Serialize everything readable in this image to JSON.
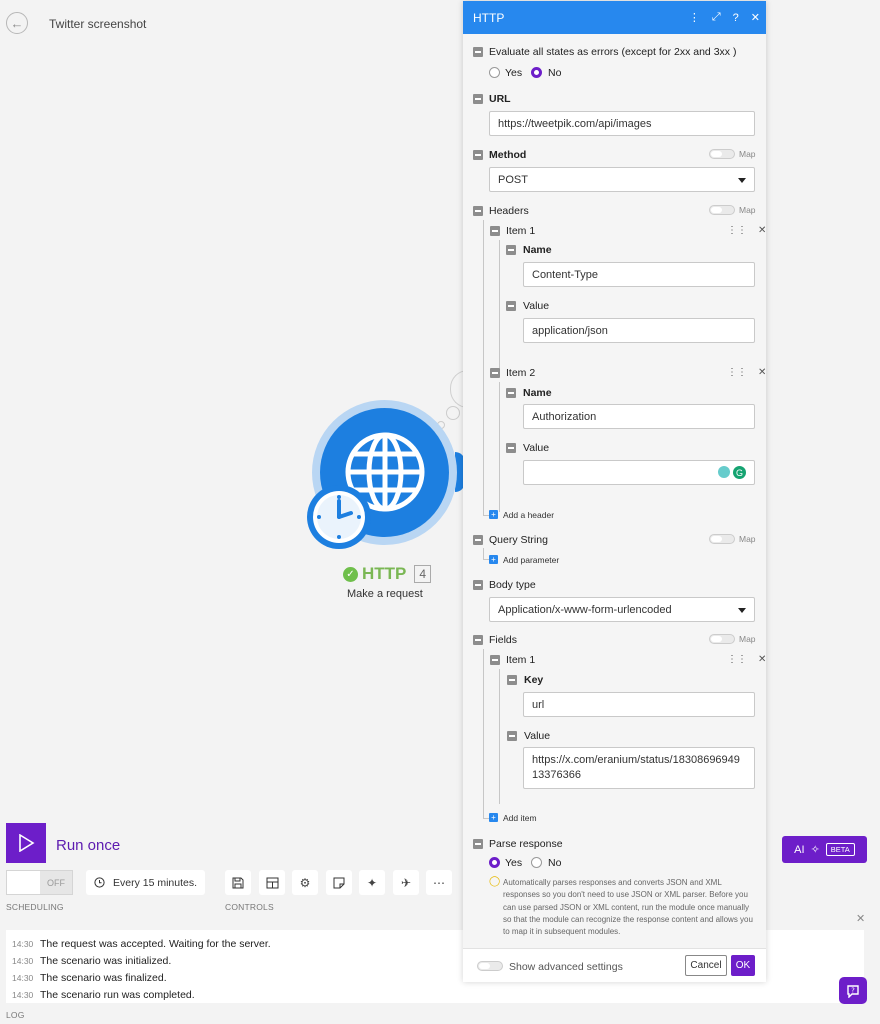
{
  "scenario": {
    "title": "Twitter screenshot"
  },
  "module": {
    "name": "HTTP",
    "count": "4",
    "subtitle": "Make a request"
  },
  "toolbar": {
    "run_label": "Run once",
    "toggle_state": "OFF",
    "schedule": "Every 15 minutes.",
    "scheduling_caption": "SCHEDULING",
    "controls_caption": "CONTROLS",
    "ai_label": "AI",
    "beta_label": "BETA"
  },
  "log": {
    "caption": "LOG",
    "entries": [
      {
        "time": "14:30",
        "message": "The request was accepted. Waiting for the server."
      },
      {
        "time": "14:30",
        "message": "The scenario was initialized."
      },
      {
        "time": "14:30",
        "message": "The scenario was finalized."
      },
      {
        "time": "14:30",
        "message": "The scenario run was completed."
      }
    ]
  },
  "panel": {
    "title": "HTTP",
    "evaluate_label": "Evaluate all states as errors (except for 2xx and 3xx )",
    "yes": "Yes",
    "no": "No",
    "map": "Map",
    "url_label": "URL",
    "url_value": "https://tweetpik.com/api/images",
    "method_label": "Method",
    "method_value": "POST",
    "headers_label": "Headers",
    "item1": "Item 1",
    "item2": "Item 2",
    "name_label": "Name",
    "value_label": "Value",
    "header1_name": "Content-Type",
    "header1_value": "application/json",
    "header2_name": "Authorization",
    "header2_value": "",
    "add_header": "Add a header",
    "query_label": "Query String",
    "add_param": "Add parameter",
    "body_type_label": "Body type",
    "body_type_value": "Application/x-www-form-urlencoded",
    "fields_label": "Fields",
    "key_label": "Key",
    "field_key": "url",
    "field_value_line1": "https://x.com/eranium/status/18308696949",
    "field_value_line2": "13376366",
    "add_item": "Add item",
    "parse_label": "Parse response",
    "parse_note": "Automatically parses responses and converts JSON and XML responses so you don't need to use JSON or XML parser. Before you can use parsed JSON or XML content, run the module once manually so that the module can recognize the response content and allows you to map it in subsequent modules.",
    "advanced": "Show advanced settings",
    "cancel": "Cancel",
    "ok": "OK"
  },
  "colors": {
    "accent": "#6d1ec9",
    "header_blue": "#2788ee",
    "module_blue": "#1d7fe0",
    "success": "#6fbf4b"
  }
}
